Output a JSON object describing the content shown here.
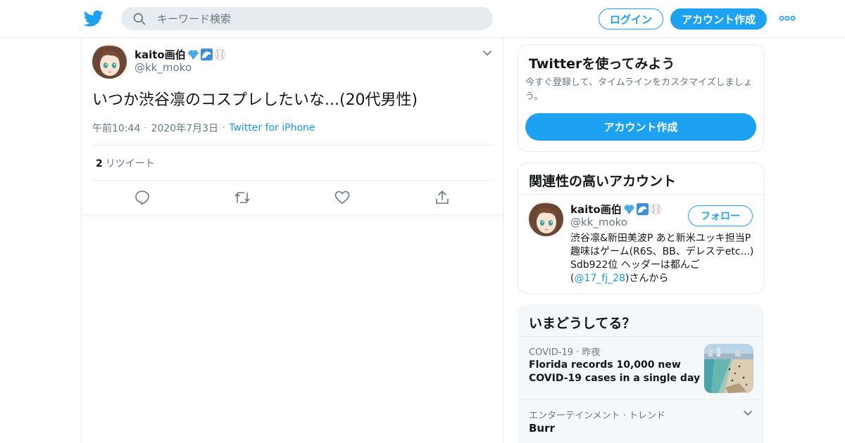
{
  "header": {
    "search_placeholder": "キーワード検索",
    "login_label": "ログイン",
    "signup_label": "アカウント作成",
    "brand_color": "#1da1f2"
  },
  "tweet": {
    "display_name": "kaito画伯",
    "name_emojis": [
      "gem-icon",
      "wave-icon",
      "baseball-icon"
    ],
    "handle": "@kk_moko",
    "text": "いつか渋谷凛のコスプレしたいな...(20代男性)",
    "time": "午前10:44",
    "date": "2020年7月3日",
    "source": "Twitter for iPhone",
    "retweet_count": "2",
    "retweet_label": "リツイート"
  },
  "signup_card": {
    "title": "Twitterを使ってみよう",
    "description": "今すぐ登録して、タイムラインをカスタマイズしましょう。",
    "button_label": "アカウント作成"
  },
  "related_card": {
    "title": "関連性の高いアカウント",
    "account": {
      "display_name": "kaito画伯",
      "handle": "@kk_moko",
      "follow_label": "フォロー",
      "bio_before": "渋谷凛&新田美波P あと新米ユッキ担当P 趣味はゲーム(R6S、BB、デレステetc...) Sdb922位 ヘッダーは都んご(",
      "bio_mention": "@17_fj_28",
      "bio_after": ")さんから"
    }
  },
  "trends_card": {
    "title": "いまどうしてる？",
    "items": [
      {
        "category": "COVID-19",
        "time": "昨夜",
        "title": "Florida records 10,000 new COVID-19 cases in a single day"
      },
      {
        "category": "エンターテインメント · トレンド",
        "title": "Burr"
      }
    ]
  }
}
